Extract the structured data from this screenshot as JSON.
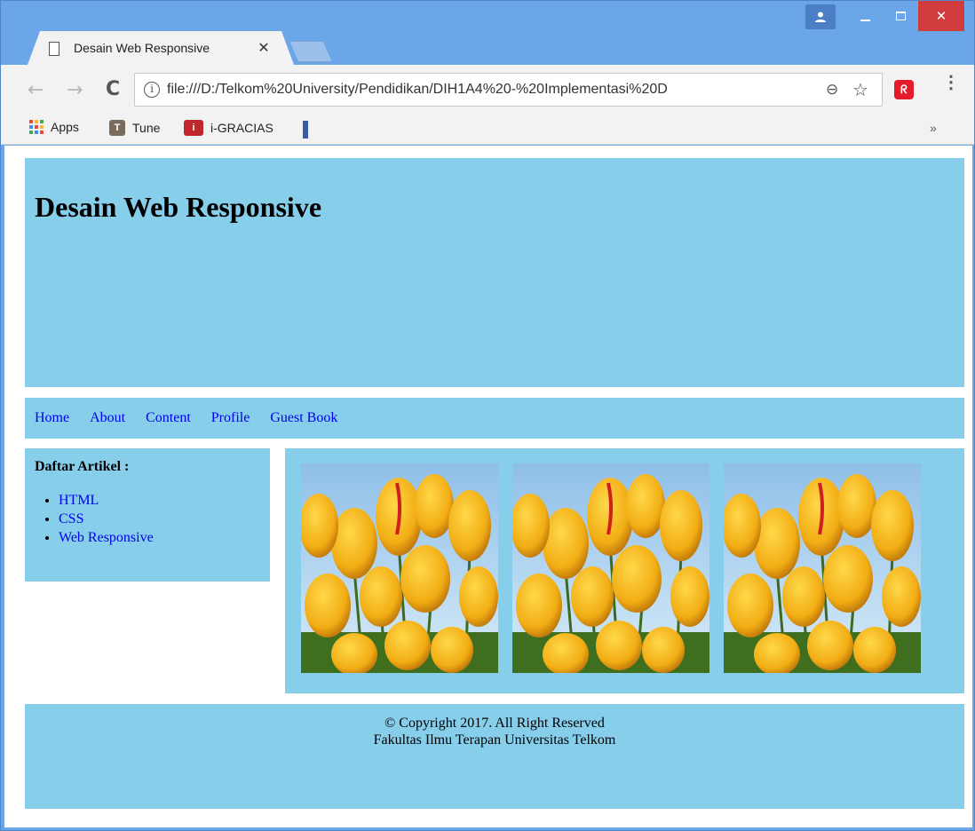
{
  "window": {
    "controls": {
      "minimize": "–",
      "maximize": "☐",
      "close": "✕"
    },
    "profile_icon": "person-icon"
  },
  "tab": {
    "title": "Desain Web Responsive",
    "close": "✕"
  },
  "toolbar": {
    "back": "←",
    "forward": "→",
    "reload": "C",
    "url": "file:///D:/Telkom%20University/Pendidikan/DIH1A4%20-%20Implementasi%20D",
    "info": "i",
    "zoom": "⊖",
    "star": "☆",
    "extension": "ᖇ",
    "menu": "⋮"
  },
  "bookmarks": {
    "items": [
      {
        "label": "Apps",
        "icon": "apps-grid-icon"
      },
      {
        "label": "Tune",
        "icon": "tune-icon"
      },
      {
        "label": "i-GRACIAS",
        "icon": "igracias-icon"
      }
    ],
    "more": "»"
  },
  "page": {
    "header": {
      "title": "Desain Web Responsive"
    },
    "nav": [
      "Home",
      "About",
      "Content",
      "Profile",
      "Guest Book"
    ],
    "sidebar": {
      "title": "Daftar Artikel :",
      "items": [
        "HTML",
        "CSS",
        "Web Responsive"
      ]
    },
    "content": {
      "images": [
        "tulip-image",
        "tulip-image",
        "tulip-image"
      ]
    },
    "footer": {
      "line1": "© Copyright 2017. All Right Reserved",
      "line2": "Fakultas Ilmu Terapan Universitas Telkom"
    }
  },
  "colors": {
    "page_panels": "#87ceeb",
    "link": "#0000ee",
    "chrome_frame": "#6aa6e8",
    "close_button": "#d23c3c"
  }
}
